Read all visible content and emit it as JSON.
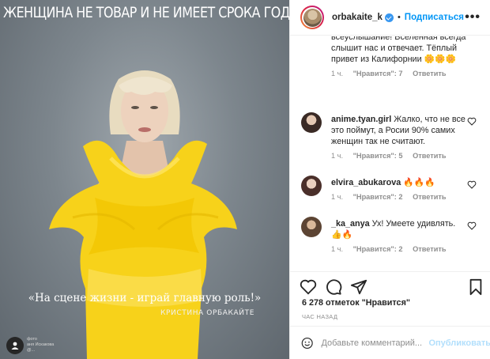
{
  "photo": {
    "title": "ЖЕНЩИНА НЕ ТОВАР И НЕ ИМЕЕТ СРОКА ГОДНОСТИ",
    "quote": "«На сцене жизни - играй главную роль!»",
    "quote_author": "КРИСТИНА ОРБАКАЙТЕ",
    "tag_caption": "фото\nаня Искакова\n@..."
  },
  "header": {
    "username": "orbakaite_k",
    "follow_label": "Подписаться",
    "more_label": "•••"
  },
  "first_comment": {
    "text": "всеуслышание! Вселенная всегда слышит нас и отвечает. Тёплый привет из Калифорнии 🌼🌼🌼",
    "time": "1 ч.",
    "likes": "\"Нравится\": 7",
    "reply": "Ответить"
  },
  "comments": [
    {
      "user": "anime.tyan.girl",
      "text": "Жалко, что не все это поймут, а Росии 90% самих женщин так не считают.",
      "time": "1 ч.",
      "likes": "\"Нравится\": 5",
      "reply": "Ответить"
    },
    {
      "user": "elvira_abukarova",
      "text": "🔥🔥🔥",
      "time": "1 ч.",
      "likes": "\"Нравится\": 2",
      "reply": "Ответить"
    },
    {
      "user": "_ka_anya",
      "text": "Ух! Умеете удивлять. 👍🔥",
      "time": "1 ч.",
      "likes": "\"Нравится\": 2",
      "reply": "Ответить"
    }
  ],
  "stats": {
    "likes": "6 278 отметок \"Нравится\"",
    "time": "ЧАС НАЗАД"
  },
  "composer": {
    "placeholder": "Добавьте комментарий...",
    "publish_label": "Опубликовать"
  },
  "colors": {
    "accent": "#0095f6",
    "muted": "#8e8e8e",
    "dress": "#f7d21a"
  }
}
